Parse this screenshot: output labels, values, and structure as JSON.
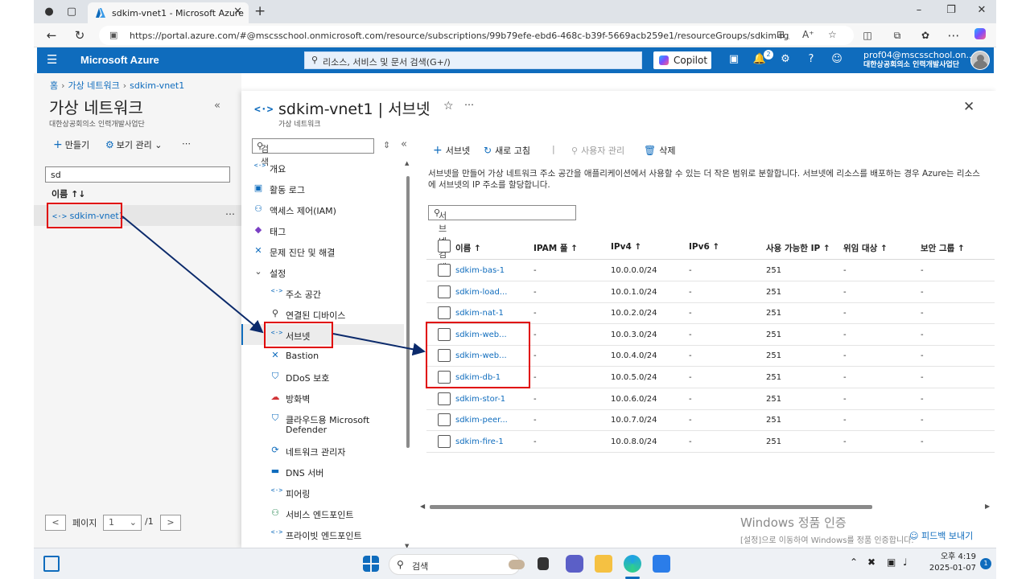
{
  "browser": {
    "tab_title": "sdkim-vnet1 - Microsoft Azure",
    "url": "https://portal.azure.com/#@mscsschool.onmicrosoft.com/resource/subscriptions/99b79efe-ebd6-468c-b39f-5669acb259e1/resourceGroups/sdkim-rg/provi..."
  },
  "azure": {
    "brand": "Microsoft Azure",
    "search_placeholder": "리소스, 서비스 및 문서 검색(G+/)",
    "copilot_label": "Copilot",
    "notification_count": "2",
    "account_email": "prof04@mscsschool.on...",
    "account_org": "대한상공회의소 인력개발사업단"
  },
  "breadcrumb": [
    "홈",
    "가상 네트워크",
    "sdkim-vnet1"
  ],
  "left_panel": {
    "title": "가상 네트워크",
    "subtitle": "대한상공회의소 인력개발사업단",
    "create_label": "만들기",
    "view_label": "보기 관리",
    "filter_value": "sd",
    "column_name": "이름 ↑↓",
    "items": [
      "sdkim-vnet1"
    ],
    "pager_label": "페이지",
    "page_value": "1",
    "page_total": "/1"
  },
  "main": {
    "title": "sdkim-vnet1 | 서브넷",
    "subtitle": "가상 네트워크",
    "menu_search_placeholder": "검색",
    "menu": [
      {
        "label": "개요",
        "icon": "vnet-icon"
      },
      {
        "label": "활동 로그",
        "icon": "log-icon"
      },
      {
        "label": "액세스 제어(IAM)",
        "icon": "people-icon"
      },
      {
        "label": "태그",
        "icon": "tag-icon"
      },
      {
        "label": "문제 진단 및 해결",
        "icon": "wrench-icon"
      },
      {
        "label": "설정",
        "icon": "chevron-down-icon"
      },
      {
        "label": "주소 공간",
        "icon": "vnet-icon"
      },
      {
        "label": "연결된 디바이스",
        "icon": "plug-icon"
      },
      {
        "label": "서브넷",
        "icon": "vnet-icon"
      },
      {
        "label": "Bastion",
        "icon": "bastion-icon"
      },
      {
        "label": "DDoS 보호",
        "icon": "shield-icon"
      },
      {
        "label": "방화벽",
        "icon": "firewall-icon"
      },
      {
        "label": "클라우드용 Microsoft",
        "label2": "Defender",
        "icon": "defender-icon"
      },
      {
        "label": "네트워크 관리자",
        "icon": "network-manager-icon"
      },
      {
        "label": "DNS 서버",
        "icon": "dns-icon"
      },
      {
        "label": "피어링",
        "icon": "peering-icon"
      },
      {
        "label": "서비스 엔드포인트",
        "icon": "endpoint-icon"
      },
      {
        "label": "프라이빗 엔드포인트",
        "icon": "private-endpoint-icon"
      }
    ],
    "toolbar": {
      "add_subnet": "서브넷",
      "refresh": "새로 고침",
      "manage_users": "사용자 관리",
      "delete": "삭제"
    },
    "description": "서브넷을 만들어 가상 네트워크 주소 공간을 애플리케이션에서 사용할 수 있는 더 작은 범위로 분할합니다. 서브넷에 리소스를 배포하는 경우 Azure는 리소스에 서브넷의 IP 주소를 할당합니다.",
    "subnet_search_placeholder": "서브넷 검색",
    "columns": [
      "이름 ↑",
      "IPAM 풀 ↑",
      "IPv4 ↑",
      "IPv6 ↑",
      "사용 가능한 IP ↑",
      "위임 대상 ↑",
      "보안 그룹 ↑"
    ],
    "rows": [
      {
        "name": "sdkim-bas-1",
        "ipam": "-",
        "ipv4": "10.0.0.0/24",
        "ipv6": "-",
        "avail": "251",
        "deleg": "-",
        "nsg": "-"
      },
      {
        "name": "sdkim-load...",
        "ipam": "-",
        "ipv4": "10.0.1.0/24",
        "ipv6": "-",
        "avail": "251",
        "deleg": "-",
        "nsg": "-"
      },
      {
        "name": "sdkim-nat-1",
        "ipam": "-",
        "ipv4": "10.0.2.0/24",
        "ipv6": "-",
        "avail": "251",
        "deleg": "-",
        "nsg": "-"
      },
      {
        "name": "sdkim-web...",
        "ipam": "-",
        "ipv4": "10.0.3.0/24",
        "ipv6": "-",
        "avail": "251",
        "deleg": "-",
        "nsg": "-"
      },
      {
        "name": "sdkim-web...",
        "ipam": "-",
        "ipv4": "10.0.4.0/24",
        "ipv6": "-",
        "avail": "251",
        "deleg": "-",
        "nsg": "-"
      },
      {
        "name": "sdkim-db-1",
        "ipam": "-",
        "ipv4": "10.0.5.0/24",
        "ipv6": "-",
        "avail": "251",
        "deleg": "-",
        "nsg": "-"
      },
      {
        "name": "sdkim-stor-1",
        "ipam": "-",
        "ipv4": "10.0.6.0/24",
        "ipv6": "-",
        "avail": "251",
        "deleg": "-",
        "nsg": "-"
      },
      {
        "name": "sdkim-peer...",
        "ipam": "-",
        "ipv4": "10.0.7.0/24",
        "ipv6": "-",
        "avail": "251",
        "deleg": "-",
        "nsg": "-"
      },
      {
        "name": "sdkim-fire-1",
        "ipam": "-",
        "ipv4": "10.0.8.0/24",
        "ipv6": "-",
        "avail": "251",
        "deleg": "-",
        "nsg": "-"
      }
    ],
    "feedback": "피드백 보내기",
    "watermark_line1": "Windows 정품 인증",
    "watermark_line2": "[설정]으로 이동하여 Windows를 정품 인증합니다."
  },
  "taskbar": {
    "search_label": "검색",
    "time": "오후 4:19",
    "date": "2025-01-07",
    "notification_count": "1"
  },
  "colors": {
    "azure_blue": "#0f6cbd",
    "highlight_red": "#e00000",
    "arrow_navy": "#0b2a6b"
  }
}
